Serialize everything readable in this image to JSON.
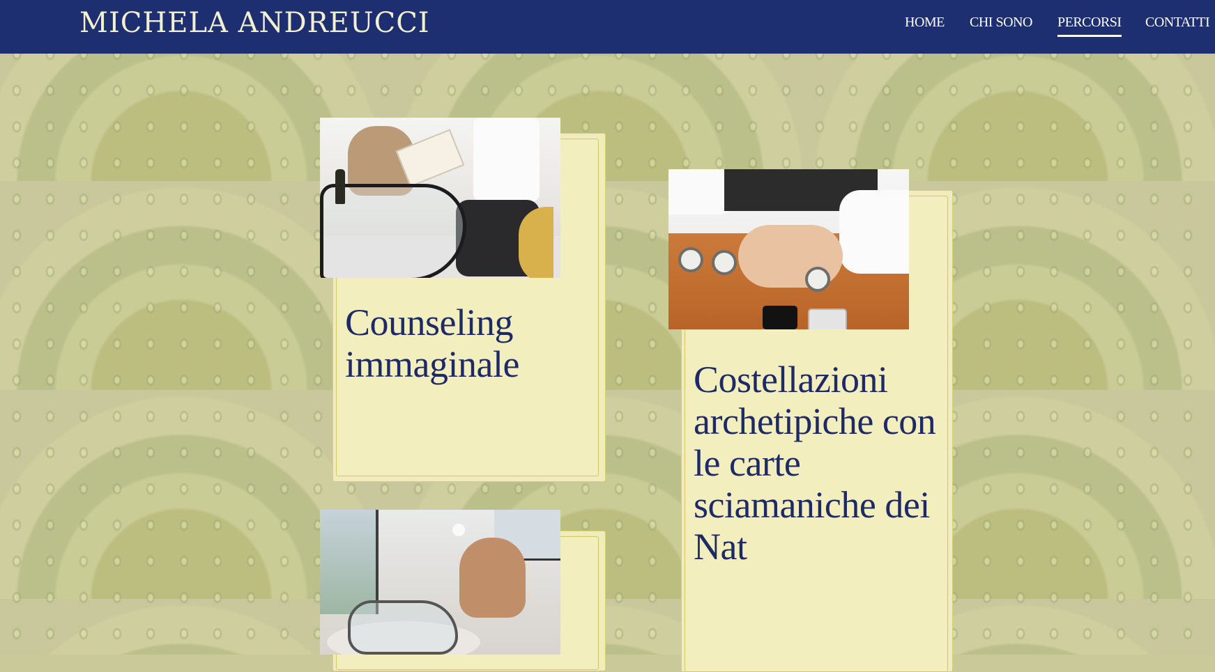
{
  "header": {
    "logo": "MICHELA ANDREUCCI",
    "nav": [
      {
        "label": "HOME",
        "active": false
      },
      {
        "label": "CHI SONO",
        "active": false
      },
      {
        "label": "PERCORSI",
        "active": true
      },
      {
        "label": "CONTATTI",
        "active": false
      }
    ]
  },
  "cards": [
    {
      "title": "Counseling immaginale"
    },
    {
      "title": "Costellazioni archetipiche con le carte sciamaniche dei Nat"
    },
    {
      "title": ""
    }
  ],
  "colors": {
    "header_bg": "#1d2f71",
    "card_bg": "#f2eebd",
    "title_text": "#1d2a66",
    "nav_text": "#ffffff",
    "logo_text": "#f3f0cf"
  }
}
